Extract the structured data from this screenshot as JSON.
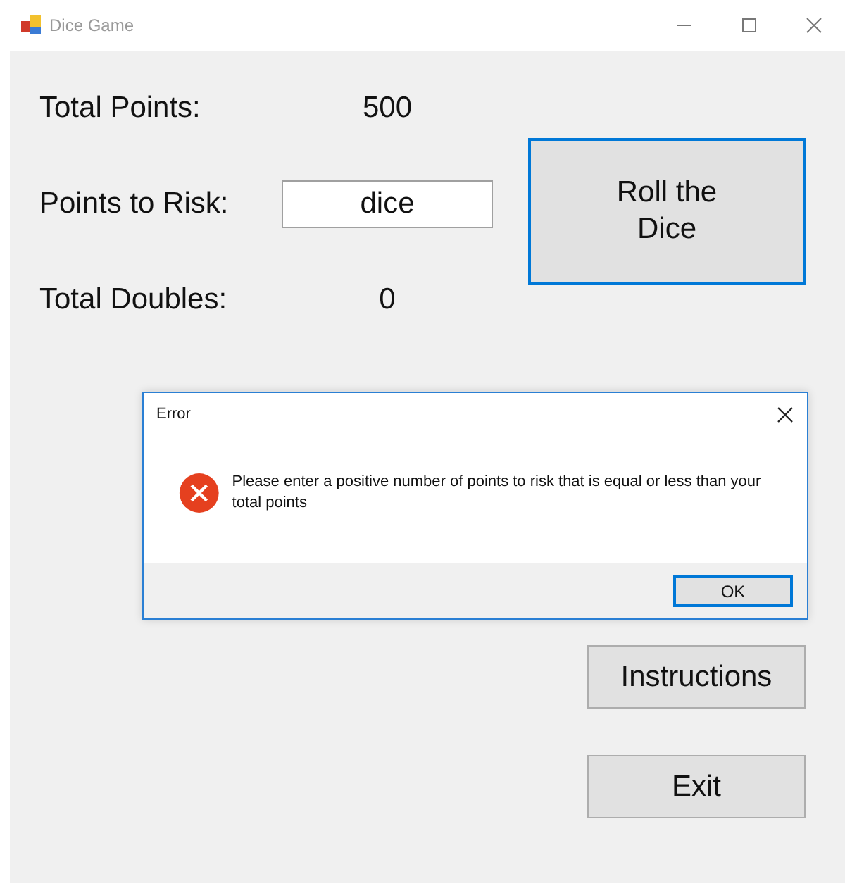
{
  "window": {
    "title": "Dice Game"
  },
  "fields": [
    {
      "kind": "readout",
      "label": "Total Points:",
      "value": "500"
    },
    {
      "kind": "input",
      "label": "Points to Risk:",
      "value": "dice"
    },
    {
      "kind": "readout",
      "label": "Total Doubles:",
      "value": "0"
    }
  ],
  "roll_button": {
    "label": "Roll the\nDice",
    "focused": true
  },
  "buttons": [
    {
      "label": "Instructions",
      "focused": false
    },
    {
      "label": "Exit",
      "focused": false
    }
  ],
  "dialog": {
    "title": "Error",
    "message": "Please enter a positive number of points to risk that is equal or less than your total points",
    "button": {
      "label": "OK",
      "focused": true
    }
  }
}
